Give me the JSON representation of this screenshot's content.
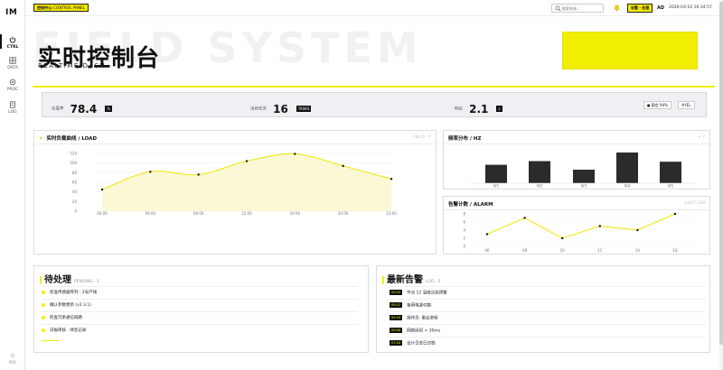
{
  "app": {
    "logo": "IM"
  },
  "sidebar": {
    "items": [
      {
        "label": "CTRL",
        "icon": "power-icon",
        "active": true
      },
      {
        "label": "DATA",
        "icon": "grid-icon",
        "active": false
      },
      {
        "label": "PROC",
        "icon": "circle-icon",
        "active": false
      },
      {
        "label": "LOG",
        "icon": "document-icon",
        "active": false
      }
    ],
    "footer": "PRO"
  },
  "topbar": {
    "crumb_cn": "控制中心",
    "crumb_en": "CONTROL PANEL",
    "search_placeholder": "搜索系统...",
    "action_label": "告警 · 处理",
    "avatar": "AD",
    "clock": "2026-03-10 16:34:57"
  },
  "hero": {
    "bg_text": "FIELD SYSTEM",
    "title": "实时控制台",
    "subtitle": "REALTIME DASH"
  },
  "stats": [
    {
      "label": "负载率",
      "value": "78.4",
      "unit": "%"
    },
    {
      "label": "当前任务",
      "value": "16",
      "unit": "TASKS"
    },
    {
      "label": "响应",
      "value": "2.1",
      "unit": "s"
    }
  ],
  "stats_chips": [
    "● 稳定 94%",
    "#YEL"
  ],
  "load_chart": {
    "header": "实时负载曲线 / LOAD",
    "meta": "FIELD · 7",
    "chart_data": {
      "type": "area",
      "title": "实时负载曲线 / LOAD",
      "categories": [
        "00:00",
        "04:00",
        "08:00",
        "12:00",
        "16:00",
        "20:00",
        "23:00"
      ],
      "values": [
        45,
        82,
        76,
        104,
        119,
        94,
        67
      ],
      "ylim": [
        0,
        120
      ],
      "yticks": [
        "0",
        "20",
        "40",
        "60",
        "80",
        "100",
        "120"
      ],
      "grid": true,
      "color": "#f2e600"
    }
  },
  "freq_chart": {
    "header": "频率分布 / HZ",
    "meta": "→ 7",
    "chart_data": {
      "type": "bar",
      "title": "频率分布 / HZ",
      "categories": [
        "W1",
        "W2",
        "W3",
        "W4",
        "W5"
      ],
      "values": [
        60,
        72,
        44,
        100,
        70
      ],
      "color": "#2b2b2b"
    }
  },
  "alarm_chart": {
    "header": "告警计数 / ALARM",
    "meta": "LAST 12H",
    "chart_data": {
      "type": "line",
      "title": "告警计数 / ALARM",
      "categories": [
        "06",
        "08",
        "10",
        "12",
        "14",
        "16"
      ],
      "values": [
        3,
        7,
        2,
        5,
        4,
        8
      ],
      "ylim": [
        0,
        8
      ],
      "yticks": [
        "0",
        "2",
        "4",
        "6",
        "8"
      ],
      "color": "#f2e600"
    }
  },
  "tasks": {
    "title": "待处理",
    "count": "PENDING · 3",
    "items": [
      "校准传感器阵列 · 2号产线",
      "确认参数更新 (v2.3.1)",
      "检查冗余通信链路",
      "日报审核 · 待签记录"
    ]
  },
  "alerts": {
    "title": "最新告警",
    "count": "LOG · 5",
    "items": [
      {
        "time": "09:42",
        "text": "节点 12 温度过高预警"
      },
      {
        "time": "09:22",
        "text": "备用电源切换"
      },
      {
        "time": "09:16",
        "text": "操作员: 重启进程"
      },
      {
        "time": "09:08",
        "text": "网络延迟 > 30ms"
      },
      {
        "time": "07:44",
        "text": "设计日志已归档"
      }
    ]
  }
}
